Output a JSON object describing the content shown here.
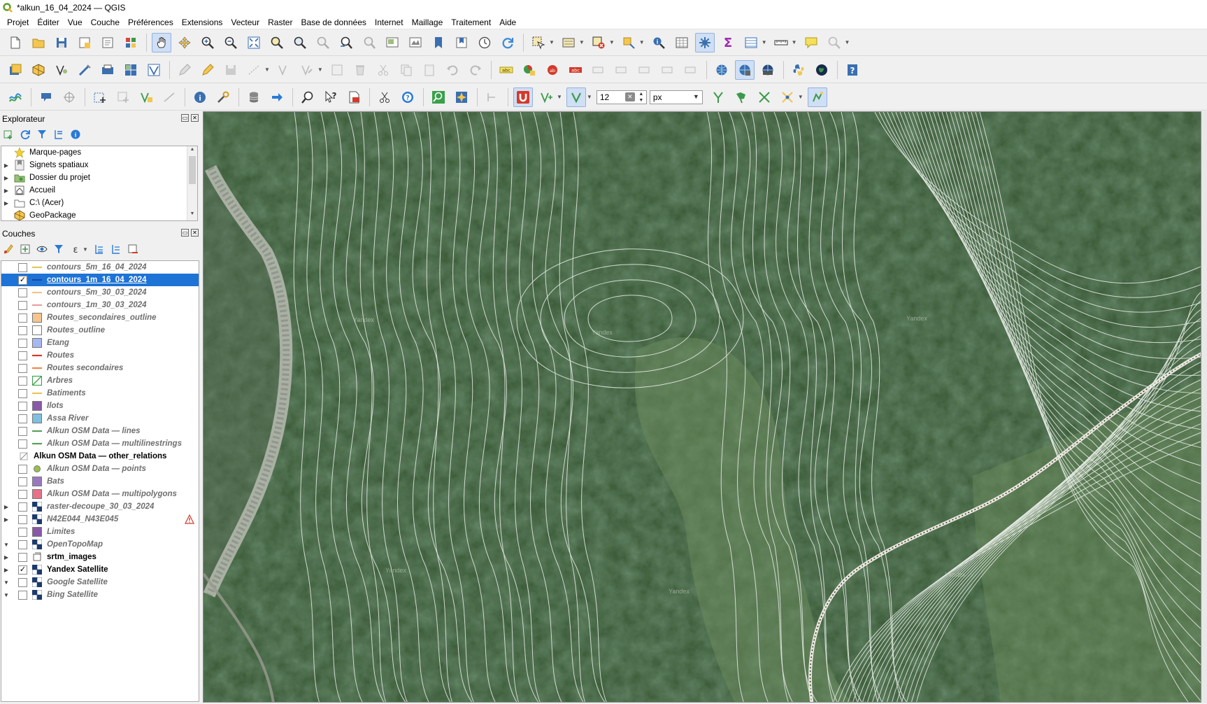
{
  "window": {
    "title": "*alkun_16_04_2024 — QGIS",
    "app_icon": "qgis-logo-icon"
  },
  "menu": [
    "Projet",
    "Éditer",
    "Vue",
    "Couche",
    "Préférences",
    "Extensions",
    "Vecteur",
    "Raster",
    "Base de données",
    "Internet",
    "Maillage",
    "Traitement",
    "Aide"
  ],
  "toolbar3": {
    "size_value": "12",
    "unit_value": "px"
  },
  "explorer": {
    "title": "Explorateur",
    "items": [
      {
        "label": "Marque-pages",
        "icon": "star-icon",
        "expandable": false
      },
      {
        "label": "Signets spatiaux",
        "icon": "spatial-bookmark-icon",
        "expandable": true
      },
      {
        "label": "Dossier du projet",
        "icon": "project-folder-icon",
        "expandable": true
      },
      {
        "label": "Accueil",
        "icon": "home-folder-icon",
        "expandable": true
      },
      {
        "label": "C:\\ (Acer)",
        "icon": "drive-icon",
        "expandable": true
      },
      {
        "label": "GeoPackage",
        "icon": "geopackage-icon",
        "expandable": false
      }
    ]
  },
  "layers": {
    "title": "Couches",
    "items": [
      {
        "name": "contours_5m_16_04_2024",
        "checked": false,
        "symbol": "line",
        "color": "#e0c860",
        "selected": false
      },
      {
        "name": "contours_1m_16_04_2024",
        "checked": true,
        "symbol": "line",
        "color": "#1b3a8c",
        "selected": true
      },
      {
        "name": "contours_5m_30_03_2024",
        "checked": false,
        "symbol": "line",
        "color": "#f0c48a",
        "selected": false
      },
      {
        "name": "contours_1m_30_03_2024",
        "checked": false,
        "symbol": "line",
        "color": "#e8a0a0",
        "selected": false
      },
      {
        "name": "Routes_secondaires_outline",
        "checked": false,
        "symbol": "fill",
        "color": "#f6c48e",
        "selected": false
      },
      {
        "name": "Routes_outline",
        "checked": false,
        "symbol": "fill",
        "color": "#ffffff",
        "selected": false
      },
      {
        "name": "Etang",
        "checked": false,
        "symbol": "fill",
        "color": "#a7b7f0",
        "selected": false
      },
      {
        "name": "Routes",
        "checked": false,
        "symbol": "line",
        "color": "#d43a2a",
        "selected": false
      },
      {
        "name": "Routes secondaires",
        "checked": false,
        "symbol": "line",
        "color": "#ee8a4a",
        "selected": false
      },
      {
        "name": "Arbres",
        "checked": false,
        "symbol": "hatch",
        "color": "#3aa04a",
        "selected": false
      },
      {
        "name": "Batiments",
        "checked": false,
        "symbol": "line",
        "color": "#e8c45a",
        "selected": false
      },
      {
        "name": "Ilots",
        "checked": false,
        "symbol": "fill",
        "color": "#8a58a8",
        "selected": false
      },
      {
        "name": "Assa River",
        "checked": false,
        "symbol": "fill",
        "color": "#7fbfdf",
        "selected": false
      },
      {
        "name": "Alkun OSM Data — lines",
        "checked": false,
        "symbol": "line",
        "color": "#5aa05a",
        "selected": false
      },
      {
        "name": "Alkun OSM Data — multilinestrings",
        "checked": false,
        "symbol": "line",
        "color": "#5aa05a",
        "selected": false
      },
      {
        "name": "Alkun OSM Data — other_relations",
        "checked": null,
        "symbol": "geometryless",
        "color": "#888888",
        "selected": false,
        "visible_style": true
      },
      {
        "name": "Alkun OSM Data — points",
        "checked": false,
        "symbol": "point",
        "color": "#9ac04a",
        "selected": false
      },
      {
        "name": "Bats",
        "checked": false,
        "symbol": "fill",
        "color": "#9a78c0",
        "selected": false
      },
      {
        "name": "Alkun OSM Data — multipolygons",
        "checked": false,
        "symbol": "fill",
        "color": "#e8708a",
        "selected": false
      },
      {
        "name": "raster-decoupe_30_03_2024",
        "checked": false,
        "symbol": "raster",
        "color": "#1b3a6c",
        "selected": false,
        "expand": "right"
      },
      {
        "name": "N42E044_N43E045",
        "checked": false,
        "symbol": "raster",
        "color": "#1b3a6c",
        "selected": false,
        "expand": "right",
        "warning": true
      },
      {
        "name": "Limites",
        "checked": false,
        "symbol": "fill",
        "color": "#8a58a8",
        "selected": false
      },
      {
        "name": "OpenTopoMap",
        "checked": false,
        "symbol": "raster",
        "color": "#1b3a6c",
        "selected": false,
        "expand": "down"
      },
      {
        "name": "srtm_images",
        "checked": false,
        "symbol": "group",
        "color": "#555555",
        "selected": false,
        "expand": "right",
        "visible_style": true
      },
      {
        "name": "Yandex Satellite",
        "checked": true,
        "symbol": "raster",
        "color": "#1b3a6c",
        "selected": false,
        "expand": "right",
        "visible_style": true
      },
      {
        "name": "Google Satellite",
        "checked": false,
        "symbol": "raster",
        "color": "#1b3a6c",
        "selected": false,
        "expand": "down"
      },
      {
        "name": "Bing Satellite",
        "checked": false,
        "symbol": "raster",
        "color": "#1b3a6c",
        "selected": false,
        "expand": "down"
      }
    ]
  },
  "map": {
    "labels": [
      "Yandex",
      "Yandex",
      "Yandex",
      "Yandex",
      "Yandex",
      "Yandex"
    ]
  }
}
